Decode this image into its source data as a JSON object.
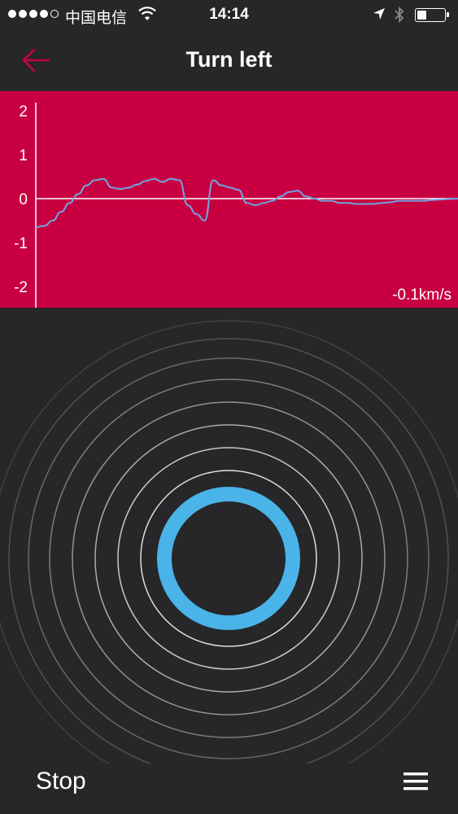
{
  "status_bar": {
    "carrier": "中国电信",
    "time": "14:14",
    "signal_bars_filled": 4,
    "signal_bars_total": 5,
    "battery_level": 0.35,
    "icons": [
      "wifi-icon",
      "location-arrow-icon",
      "bluetooth-icon",
      "battery-icon"
    ]
  },
  "nav": {
    "title": "Turn left",
    "back_icon": "arrow-left-icon"
  },
  "chart_data": {
    "type": "line",
    "title": "",
    "xlabel": "",
    "ylabel": "",
    "ylim": [
      -2,
      2
    ],
    "yticks": [
      2,
      1,
      0,
      -1,
      -2
    ],
    "xlim": [
      0,
      100
    ],
    "series": [
      {
        "x": [
          0,
          2,
          4,
          6,
          8,
          10,
          12,
          14,
          16,
          18,
          20,
          22,
          24,
          26,
          28,
          30,
          32,
          34,
          36,
          38,
          40,
          42,
          44,
          46,
          48,
          50,
          52,
          54,
          56,
          58,
          60,
          62,
          64,
          66,
          68,
          70,
          72,
          74,
          76,
          78,
          80,
          82,
          84,
          86,
          88,
          90,
          92,
          94,
          96,
          98,
          100
        ],
        "values": [
          -0.65,
          -0.62,
          -0.5,
          -0.3,
          -0.1,
          0.1,
          0.3,
          0.42,
          0.45,
          0.25,
          0.22,
          0.25,
          0.32,
          0.4,
          0.45,
          0.38,
          0.45,
          0.42,
          -0.15,
          -0.35,
          -0.5,
          0.42,
          0.3,
          0.25,
          0.2,
          -0.1,
          -0.15,
          -0.1,
          -0.05,
          0.05,
          0.15,
          0.18,
          0.05,
          0.0,
          -0.05,
          -0.05,
          -0.1,
          -0.1,
          -0.12,
          -0.12,
          -0.12,
          -0.1,
          -0.08,
          -0.05,
          -0.05,
          -0.05,
          -0.05,
          -0.03,
          -0.02,
          -0.01,
          0.0
        ]
      }
    ],
    "colors": {
      "background": "#c80042",
      "axis": "#ffffff",
      "line": "#6fa6e0"
    }
  },
  "speed": {
    "value": "-0.1km/s"
  },
  "rings": {
    "count": 8,
    "core_color": "#4ab3e8",
    "ring_color": "#ffffff"
  },
  "footer": {
    "stop_label": "Stop",
    "menu_icon": "hamburger-menu-icon"
  },
  "colors": {
    "background": "#272628",
    "accent": "#c80042"
  }
}
